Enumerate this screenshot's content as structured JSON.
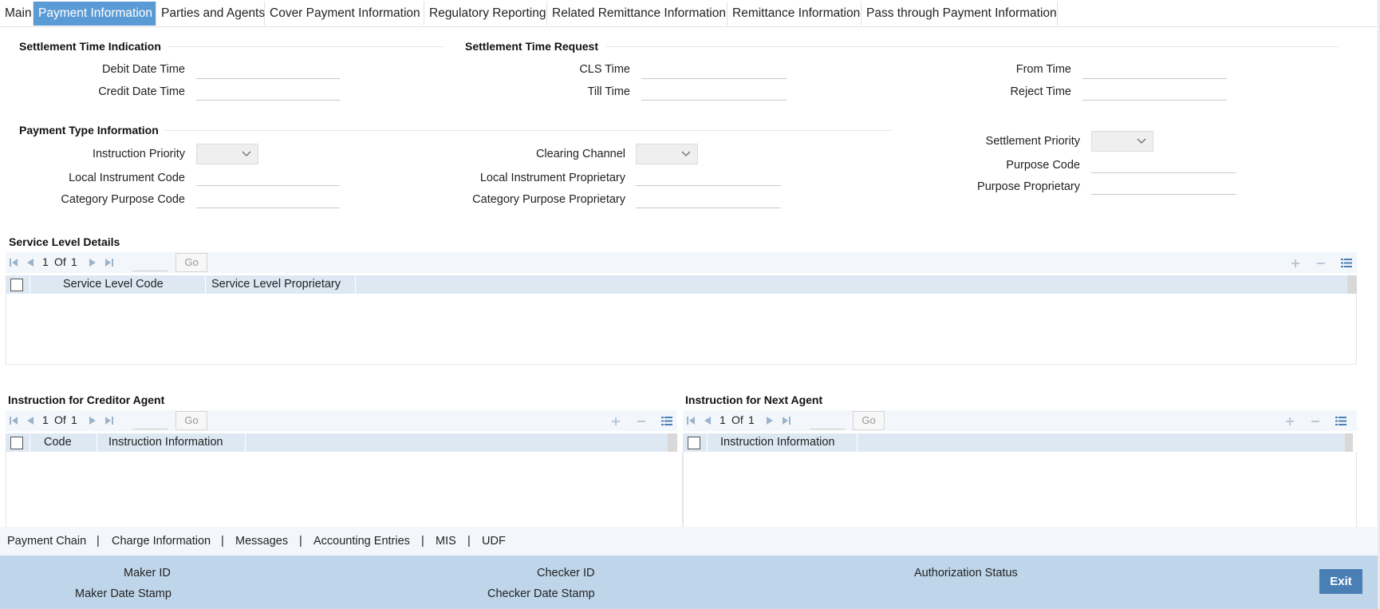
{
  "tabs": [
    "Main",
    "Payment Information",
    "Parties and Agents",
    "Cover Payment Information",
    "Regulatory Reporting",
    "Related Remittance Information",
    "Remittance Information",
    "Pass through Payment Information"
  ],
  "settlement_time_indication": {
    "title": "Settlement Time Indication",
    "debit_label": "Debit Date Time",
    "credit_label": "Credit Date Time"
  },
  "settlement_time_request": {
    "title": "Settlement Time Request",
    "cls_label": "CLS Time",
    "till_label": "Till Time",
    "from_label": "From Time",
    "reject_label": "Reject Time"
  },
  "payment_type_information": {
    "title": "Payment Type Information",
    "instruction_priority": "Instruction Priority",
    "local_instrument_code": "Local Instrument Code",
    "category_purpose_code": "Category Purpose Code",
    "clearing_channel": "Clearing Channel",
    "local_instrument_proprietary": "Local Instrument Proprietary",
    "category_purpose_proprietary": "Category Purpose Proprietary",
    "settlement_priority": "Settlement Priority",
    "purpose_code": "Purpose Code",
    "purpose_proprietary": "Purpose Proprietary"
  },
  "service_level": {
    "title": "Service Level Details",
    "page_current": "1",
    "page_of": "Of",
    "page_total": "1",
    "go": "Go",
    "columns": [
      "Service Level Code",
      "Service Level Proprietary"
    ]
  },
  "creditor_agent": {
    "title": "Instruction for Creditor Agent",
    "page_current": "1",
    "page_of": "Of",
    "page_total": "1",
    "go": "Go",
    "columns": [
      "Code",
      "Instruction Information"
    ]
  },
  "next_agent": {
    "title": "Instruction for Next Agent",
    "page_current": "1",
    "page_of": "Of",
    "page_total": "1",
    "go": "Go",
    "columns": [
      "Instruction Information"
    ]
  },
  "links": [
    "Payment Chain",
    "Charge Information",
    "Messages",
    "Accounting Entries",
    "MIS",
    "UDF"
  ],
  "link_separator": "|",
  "footer": {
    "maker_id": "Maker ID",
    "maker_date_stamp": "Maker Date Stamp",
    "checker_id": "Checker ID",
    "checker_date_stamp": "Checker Date Stamp",
    "authorization_status": "Authorization Status",
    "exit": "Exit"
  },
  "colors": {
    "active_tab": "#5b9bd5",
    "grid_header": "#dde8f3",
    "footer": "#bfd6ea",
    "exit_button": "#4a7fb5"
  }
}
